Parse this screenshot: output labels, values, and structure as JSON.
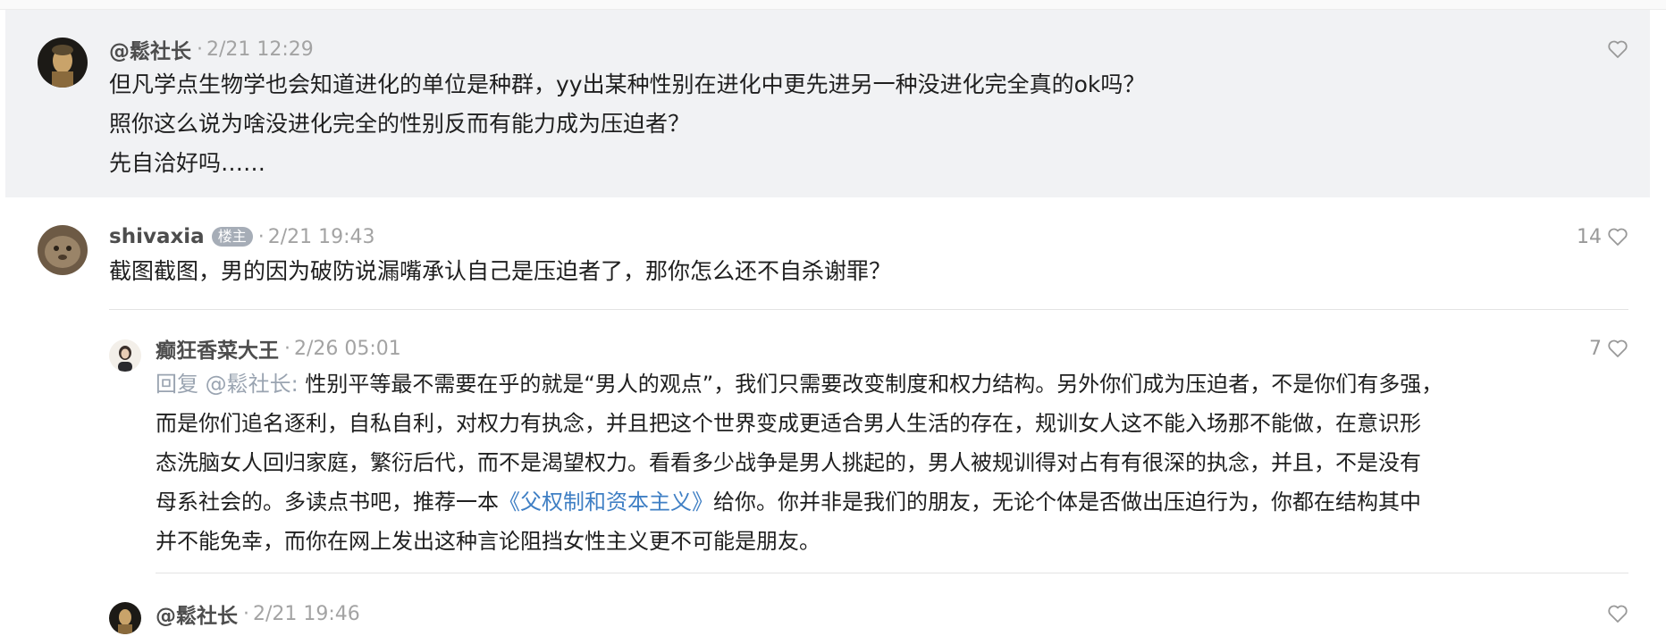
{
  "comments": [
    {
      "username": "@鬆社长",
      "time": "2/21 12:29",
      "likes": "",
      "lines": [
        "但凡学点生物学也会知道进化的单位是种群，yy出某种性别在进化中更先进另一种没进化完全真的ok吗？",
        "照你这么说为啥没进化完全的性别反而有能力成为压迫者？",
        "先自洽好吗……"
      ]
    },
    {
      "username": "shivaxia",
      "badge": "楼主",
      "time": "2/21 19:43",
      "likes": "14",
      "lines": [
        "截图截图，男的因为破防说漏嘴承认自己是压迫者了，那你怎么还不自杀谢罪？"
      ]
    }
  ],
  "replies": [
    {
      "username": "癫狂香菜大王",
      "time": "2/26 05:01",
      "likes": "7",
      "reply_prefix": "回复 @鬆社长:",
      "line1": " 性别平等最不需要在乎的就是“男人的观点”，我们只需要改变制度和权力结构。另外你们成为压迫者，不是你们有多强，",
      "line2": "而是你们追名逐利，自私自利，对权力有执念，并且把这个世界变成更适合男人生活的存在，规训女人这不能入场那不能做，在意识形",
      "line3": "态洗脑女人回归家庭，繁衍后代，而不是渴望权力。看看多少战争是男人挑起的，男人被规训得对占有有很深的执念，并且，不是没有",
      "line4_a": "母系社会的。多读点书吧，推荐一本",
      "book": "《父权制和资本主义》",
      "line4_b": "给你。你并非是我们的朋友，无论个体是否做出压迫行为，你都在结构其中",
      "line5": "并不能免幸，而你在网上发出这种言论阻挡女性主义更不可能是朋友。"
    },
    {
      "username": "@鬆社长",
      "time": "2/21 19:46",
      "likes": ""
    }
  ],
  "separator": "·",
  "icons": [
    "heart-outline-icon",
    "avatar-image"
  ],
  "colors": {
    "highlight_bg": "#f1f2f4",
    "link": "#3f7fc4",
    "reply_prefix": "#9aa4b1",
    "badge_bg": "#a6adb7"
  }
}
